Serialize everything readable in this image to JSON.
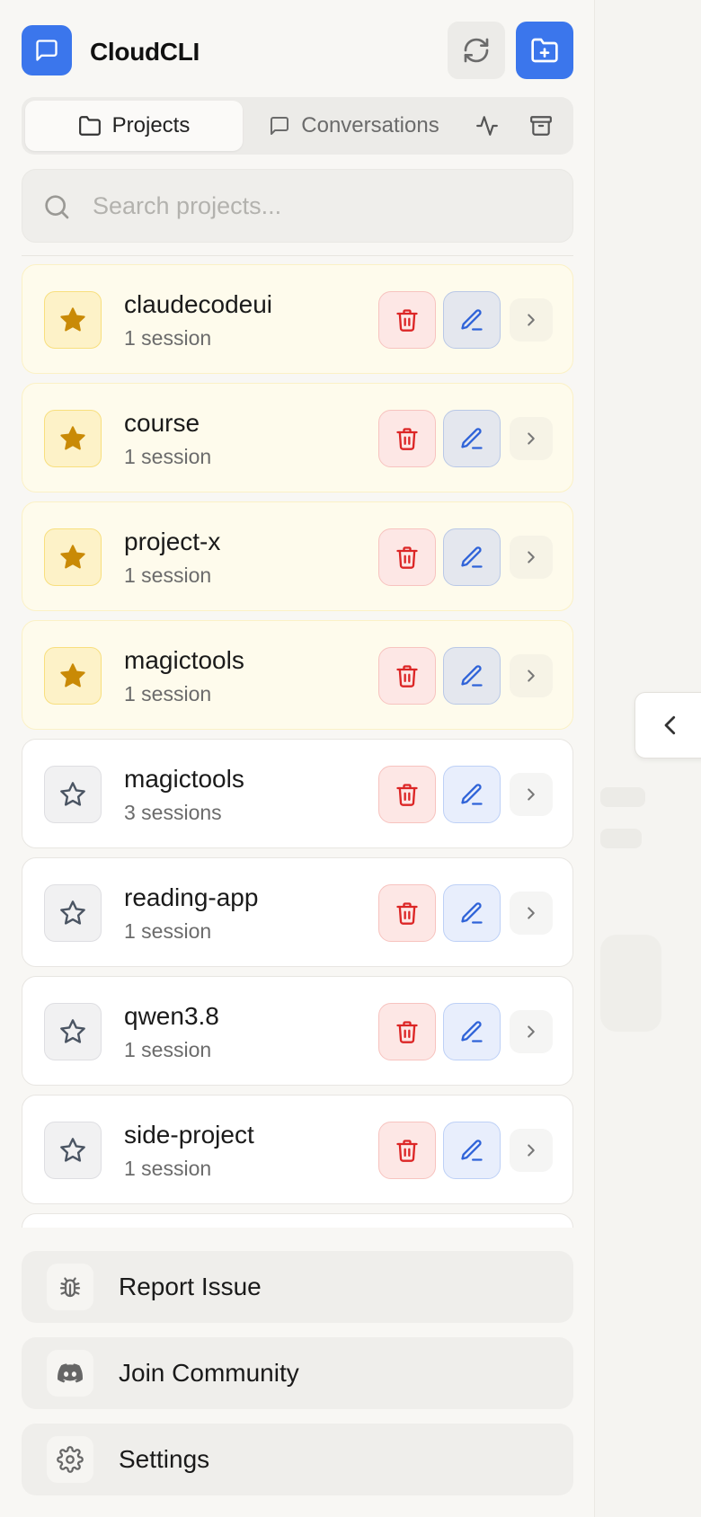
{
  "header": {
    "title": "CloudCLI"
  },
  "tabs": [
    {
      "label": "Projects",
      "active": true
    },
    {
      "label": "Conversations",
      "active": false
    }
  ],
  "search": {
    "placeholder": "Search projects..."
  },
  "projects": [
    {
      "name": "claudecodeui",
      "sessions": "1 session",
      "favorite": true
    },
    {
      "name": "course",
      "sessions": "1 session",
      "favorite": true
    },
    {
      "name": "project-x",
      "sessions": "1 session",
      "favorite": true
    },
    {
      "name": "magictools",
      "sessions": "1 session",
      "favorite": true
    },
    {
      "name": "magictools",
      "sessions": "3 sessions",
      "favorite": false
    },
    {
      "name": "reading-app",
      "sessions": "1 session",
      "favorite": false
    },
    {
      "name": "qwen3.8",
      "sessions": "1 session",
      "favorite": false
    },
    {
      "name": "side-project",
      "sessions": "1 session",
      "favorite": false
    }
  ],
  "footer": [
    {
      "label": "Report Issue",
      "icon": "bug-icon"
    },
    {
      "label": "Join Community",
      "icon": "discord-icon"
    },
    {
      "label": "Settings",
      "icon": "gear-icon"
    }
  ],
  "colors": {
    "accent": "#3b76ec",
    "danger": "#dc2626",
    "star": "#c98a06"
  }
}
